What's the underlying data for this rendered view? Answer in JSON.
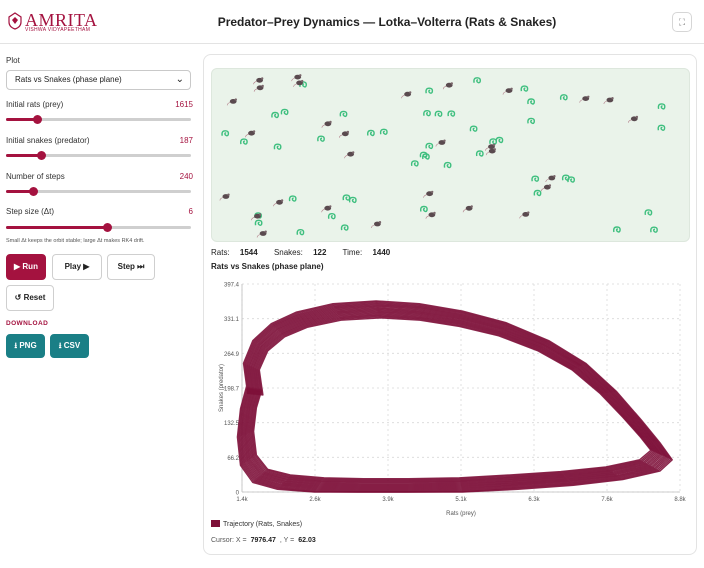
{
  "header": {
    "logo_text": "AMRITA",
    "logo_sub": "VISHWA VIDYAPEETHAM",
    "title": "Predator–Prey Dynamics — Lotka–Volterra (Rats & Snakes)",
    "fullscreen_icon": "fullscreen-icon"
  },
  "sidebar": {
    "plot_label": "Plot",
    "plot_selected": "Rats vs Snakes (phase plane)",
    "initial_rats_label": "Initial rats (prey)",
    "initial_rats_value": "1615",
    "initial_rats_fraction": 0.17,
    "initial_snakes_label": "Initial snakes (predator)",
    "initial_snakes_value": "187",
    "initial_snakes_fraction": 0.19,
    "steps_label": "Number of steps",
    "steps_value": "240",
    "steps_fraction": 0.15,
    "dt_label": "Step size (Δt)",
    "dt_value": "6",
    "dt_fraction": 0.55,
    "note": "Small Δt keeps the orbit stable; large Δt makes RK4 drift.",
    "run_label": "▶ Run",
    "play_label": "Play ▶",
    "step_label": "Step ⏭",
    "reset_label": "↺ Reset",
    "download_label": "DOWNLOAD",
    "png_label": "⭳ PNG",
    "csv_label": "⭳ CSV"
  },
  "sim": {
    "rats_label": "Rats:",
    "rats_value": "1544",
    "snakes_label": "Snakes:",
    "snakes_value": "122",
    "time_label": "Time:",
    "time_value": "1440"
  },
  "colors": {
    "accent": "#a4123f",
    "teal": "#1a7f86",
    "trajectory": "#7d1038",
    "field": "#eaf3ea",
    "snake": "#3fbf7f"
  },
  "chart_title": "Rats vs Snakes (phase plane)",
  "legend_label": "Trajectory (Rats, Snakes)",
  "cursor": {
    "x_label": "Cursor: X =",
    "x_value": "7976.47",
    "y_label": ", Y =",
    "y_value": "62.03"
  },
  "chart_data": {
    "type": "line",
    "title": "",
    "xlabel": "Rats (prey)",
    "ylabel": "Snakes (predator)",
    "xlim": [
      1400,
      8800
    ],
    "ylim": [
      0,
      397.4
    ],
    "x_ticks": [
      "1.4k",
      "2.6k",
      "3.9k",
      "5.1k",
      "6.3k",
      "7.6k",
      "8.8k"
    ],
    "y_ticks": [
      "0",
      "66.2",
      "132.5",
      "198.7",
      "264.9",
      "331.1",
      "397.4"
    ],
    "series": [
      {
        "name": "Trajectory (Rats, Snakes)",
        "x": [
          1615,
          1550,
          1700,
          2000,
          2400,
          3000,
          3700,
          4400,
          5100,
          5800,
          6500,
          7100,
          7600,
          8000,
          8300,
          8500,
          8300,
          7700,
          6900,
          6000,
          5100,
          4200,
          3400,
          2700,
          2100,
          1700,
          1500,
          1450,
          1500,
          1600
        ],
        "y": [
          187,
          240,
          280,
          310,
          330,
          345,
          350,
          345,
          332,
          312,
          280,
          240,
          190,
          140,
          100,
          70,
          50,
          35,
          25,
          18,
          12,
          10,
          10,
          12,
          18,
          30,
          60,
          110,
          160,
          200
        ]
      }
    ]
  }
}
